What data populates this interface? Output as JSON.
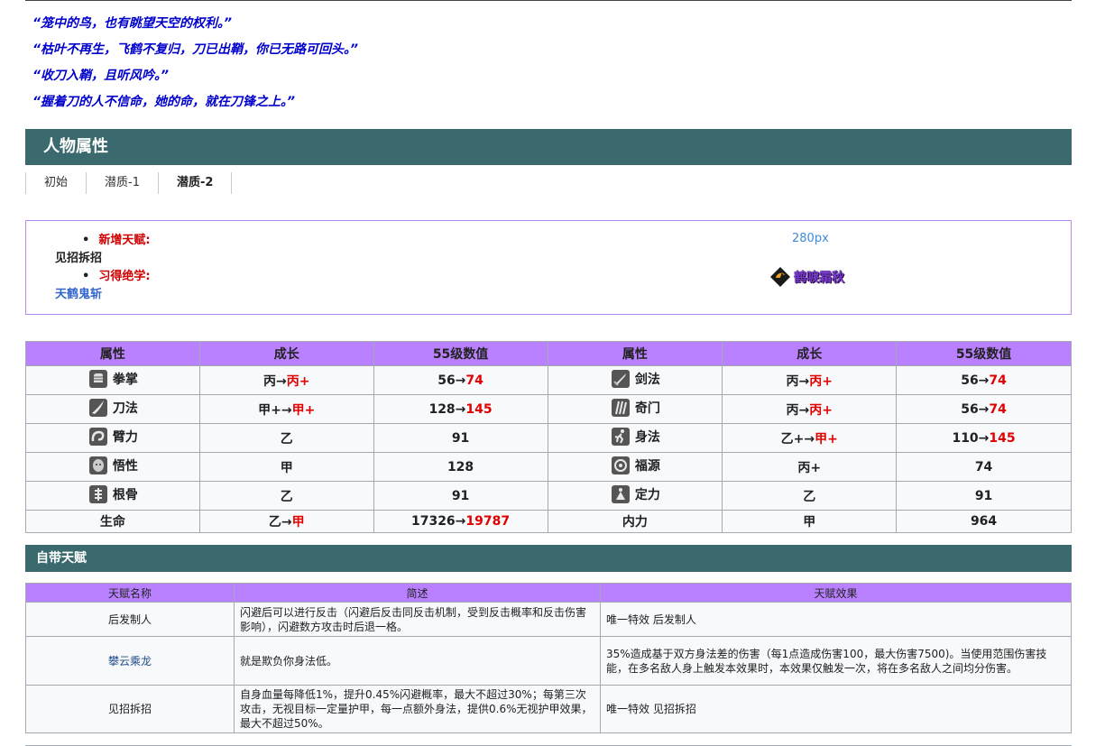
{
  "quotes": [
    "“笼中的鸟，也有眺望天空的权利。”",
    "“枯叶不再生，飞鹤不复归，刀已出鞘，你已无路可回头。”",
    "“收刀入鞘，且听风吟。”",
    "“握着刀的人不信命，她的命，就在刀锋之上。”"
  ],
  "attr_section": {
    "title": "人物属性"
  },
  "tabs": [
    "初始",
    "潜质-1",
    "潜质-2"
  ],
  "infobox": {
    "talent_label": "新增天赋:",
    "talent_value": "见招拆招",
    "skill_label": "习得绝学:",
    "skill_value": "天鹤鬼斩",
    "px_text": "280px",
    "skill_badge": "鹤唳霜秋"
  },
  "attr_table": {
    "headers": [
      "属性",
      "成长",
      "55级数值",
      "属性",
      "成长",
      "55级数值"
    ],
    "rows": [
      [
        {
          "icon": "fist-icon",
          "name": "拳掌",
          "growth_from": "丙→",
          "growth_to": "丙+",
          "val_from": "56→",
          "val_to": "74"
        },
        {
          "icon": "sword-icon",
          "name": "剑法",
          "growth_from": "丙→",
          "growth_to": "丙+",
          "val_from": "56→",
          "val_to": "74"
        }
      ],
      [
        {
          "icon": "blade-icon",
          "name": "刀法",
          "growth_from": "甲+→",
          "growth_to": "甲+",
          "val_from": "128→",
          "val_to": "145"
        },
        {
          "icon": "claw-icon",
          "name": "奇门",
          "growth_from": "丙→",
          "growth_to": "丙+",
          "val_from": "56→",
          "val_to": "74"
        }
      ],
      [
        {
          "icon": "arm-icon",
          "name": "臂力",
          "growth_from": "乙",
          "growth_to": "",
          "val_from": "91",
          "val_to": ""
        },
        {
          "icon": "runner-icon",
          "name": "身法",
          "growth_from": "乙+→",
          "growth_to": "甲+",
          "val_from": "110→",
          "val_to": "145"
        }
      ],
      [
        {
          "icon": "mind-icon",
          "name": "悟性",
          "growth_from": "甲",
          "growth_to": "",
          "val_from": "128",
          "val_to": ""
        },
        {
          "icon": "fortune-icon",
          "name": "福源",
          "growth_from": "丙+",
          "growth_to": "",
          "val_from": "74",
          "val_to": ""
        }
      ],
      [
        {
          "icon": "bone-icon",
          "name": "根骨",
          "growth_from": "乙",
          "growth_to": "",
          "val_from": "91",
          "val_to": ""
        },
        {
          "icon": "meditate-icon",
          "name": "定力",
          "growth_from": "乙",
          "growth_to": "",
          "val_from": "91",
          "val_to": ""
        }
      ]
    ],
    "last_row": {
      "left_name": "生命",
      "left_growth_from": "乙→",
      "left_growth_to": "甲",
      "left_val_from": "17326→",
      "left_val_to": "19787",
      "right_name": "内力",
      "right_growth": "甲",
      "right_val": "964"
    }
  },
  "talent_section": {
    "title": "自带天赋"
  },
  "talent_table": {
    "headers": [
      "天赋名称",
      "简述",
      "天赋效果"
    ],
    "rows": [
      {
        "name": "后发制人",
        "desc": "闪避后可以进行反击（闪避后反击同反击机制，受到反击概率和反击伤害影响），闪避数方攻击时后退一格。",
        "effect": "唯一特效 后发制人",
        "link": false
      },
      {
        "name": "攀云乘龙",
        "desc": "就是欺负你身法低。",
        "effect": "35%造成基于双方身法差的伤害（每1点造成伤害100，最大伤害7500)。当使用范围伤害技能，在多名敌人身上触发本效果时，本效果仅触发一次，将在多名敌人之间均分伤害。",
        "link": true
      },
      {
        "name": "见招拆招",
        "desc": "自身血量每降低1%，提升0.45%闪避概率，最大不超过30%；每第三次攻击，无视目标一定量护甲，每一点额外身法，提供0.6%无视护甲效果，最大不超过50%。",
        "effect": "唯一特效 见招拆招",
        "link": false
      }
    ]
  }
}
